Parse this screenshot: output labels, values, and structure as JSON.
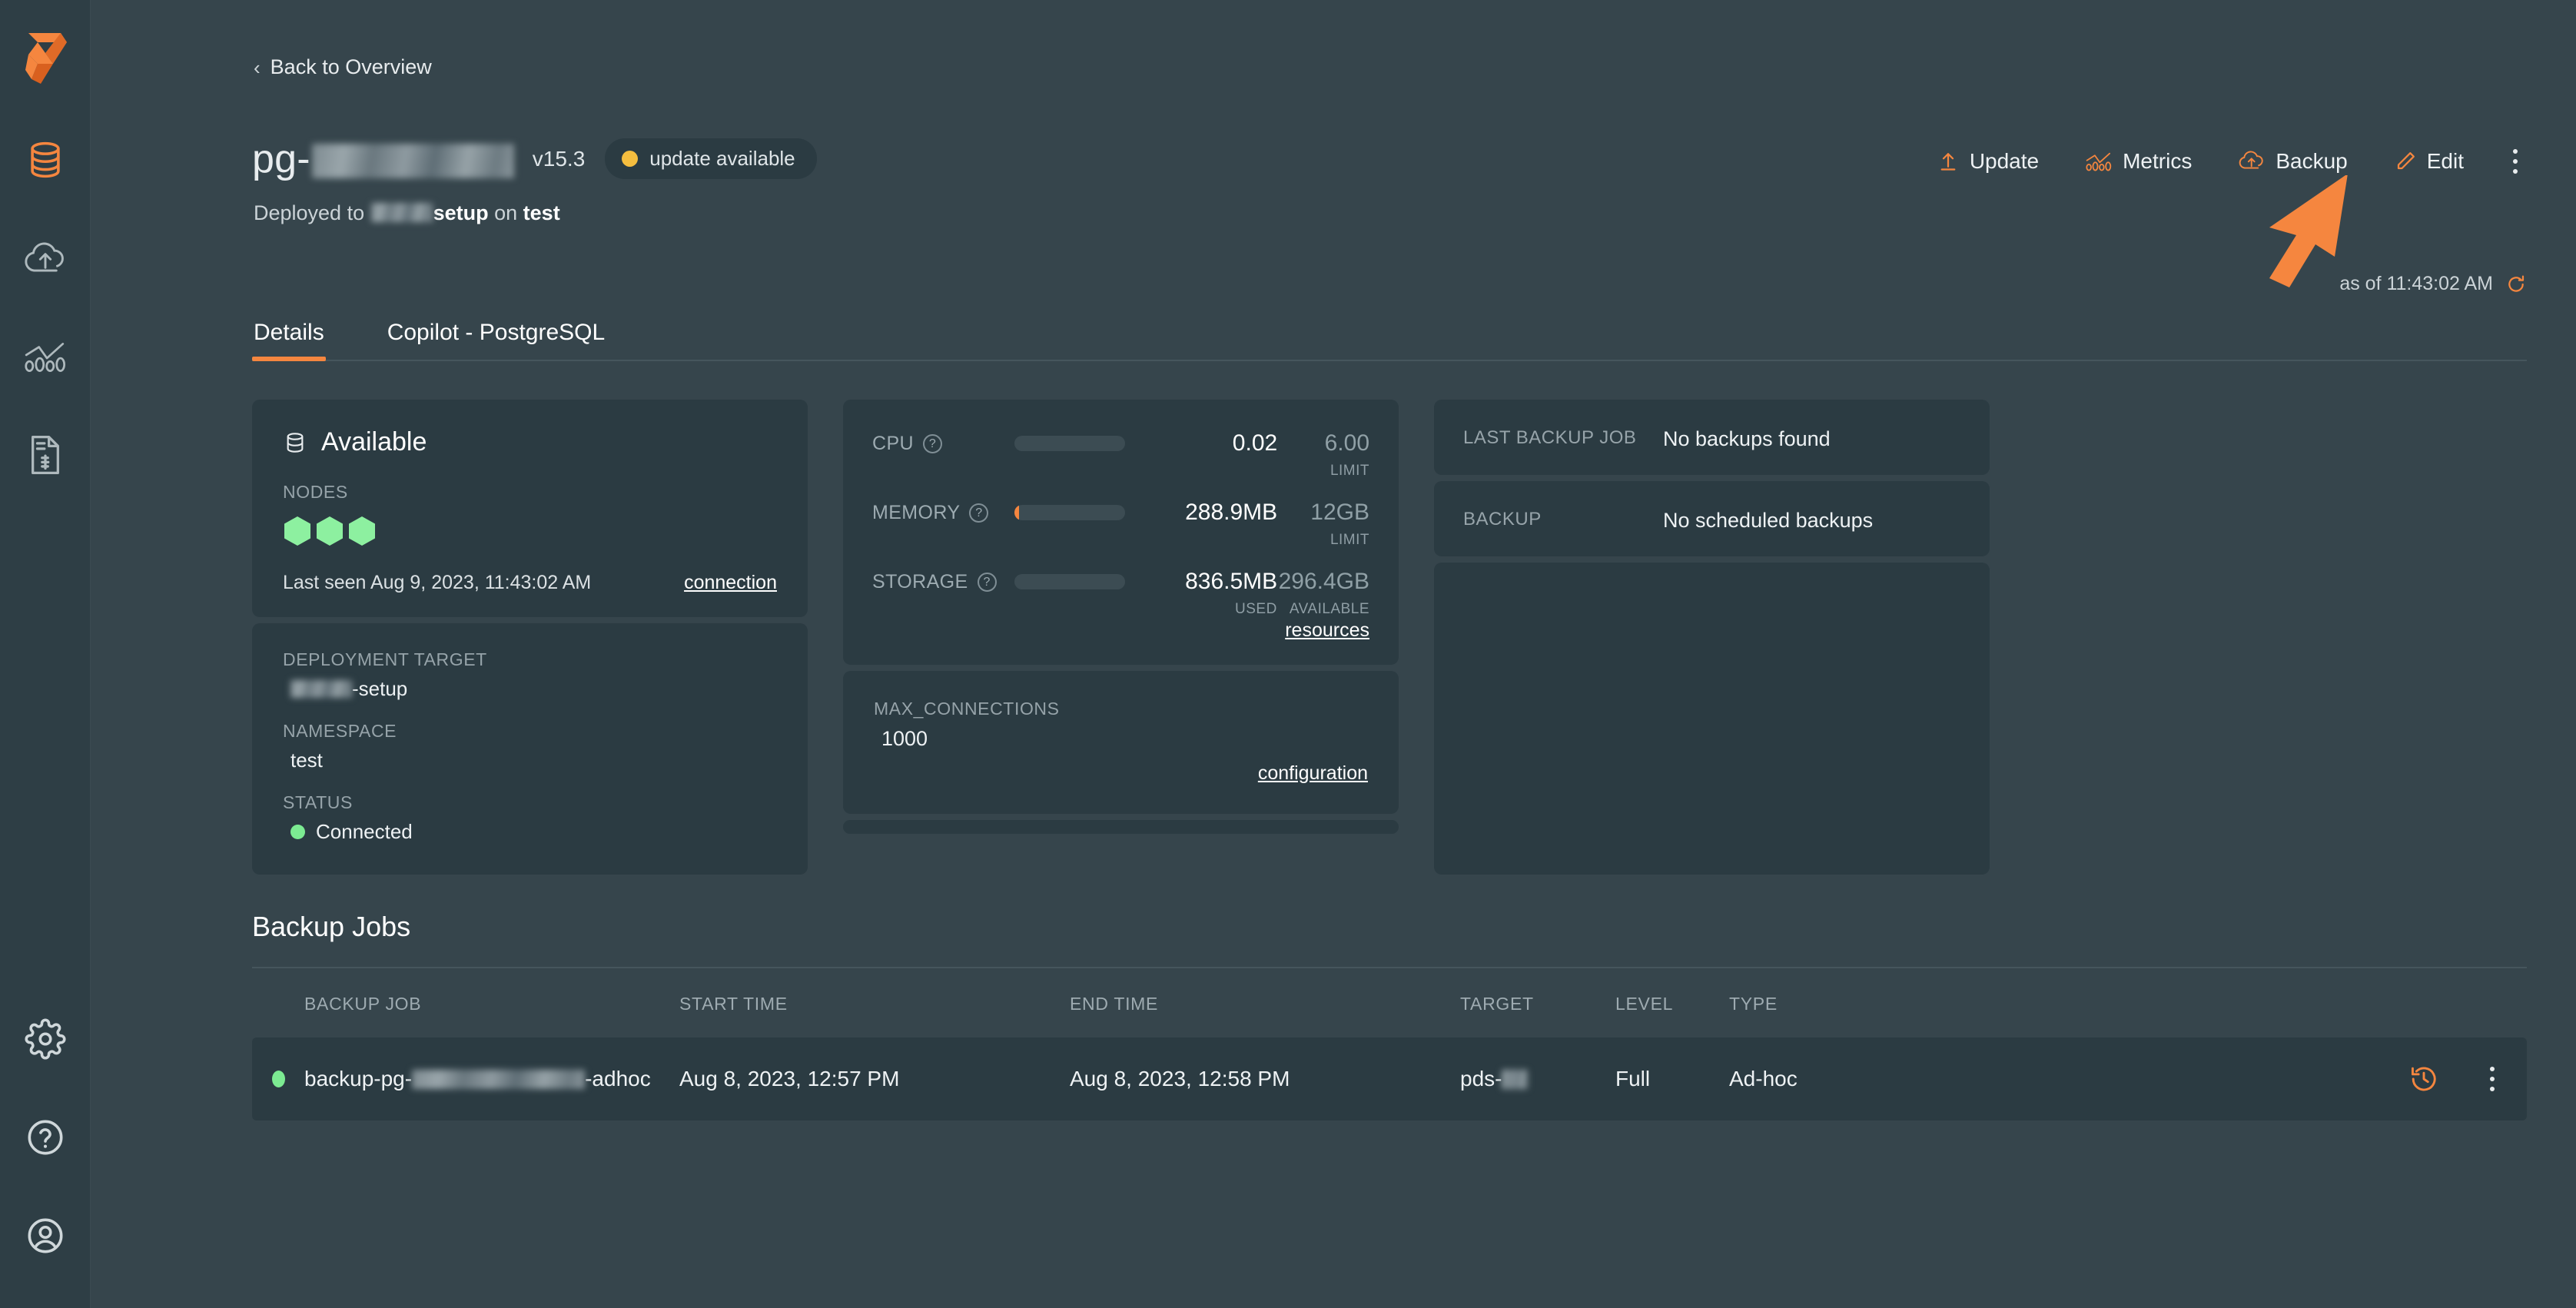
{
  "sidebar": {
    "items": [
      {
        "icon": "brand-logo-icon",
        "label": "brand-logo"
      },
      {
        "icon": "database-icon",
        "label": "Databases",
        "active": true
      },
      {
        "icon": "cloud-upload-icon",
        "label": "Deployments"
      },
      {
        "icon": "metrics-chart-icon",
        "label": "Metrics"
      },
      {
        "icon": "billing-document-icon",
        "label": "Billing"
      }
    ],
    "bottom_items": [
      {
        "icon": "gear-icon",
        "label": "Settings"
      },
      {
        "icon": "help-circle-icon",
        "label": "Help"
      },
      {
        "icon": "user-circle-icon",
        "label": "Account"
      }
    ]
  },
  "header": {
    "back_label": "Back to Overview",
    "back_icon": "chevron-left-icon",
    "title_prefix": "pg-",
    "title_redacted": true,
    "version": "v15.3",
    "badge_label": "update available",
    "badge_dot_color": "#f5be3f",
    "subtitle_prefix": "Deployed to ",
    "subtitle_target_suffix": "setup",
    "subtitle_middle": " on ",
    "subtitle_namespace": "test",
    "as_of": "as of 11:43:02 AM",
    "refresh_icon": "refresh-icon"
  },
  "actions": [
    {
      "label": "Update",
      "icon": "update-arrow-icon"
    },
    {
      "label": "Metrics",
      "icon": "metrics-chart-icon"
    },
    {
      "label": "Backup",
      "icon": "cloud-upload-icon"
    },
    {
      "label": "Edit",
      "icon": "pencil-icon"
    }
  ],
  "tabs": [
    {
      "label": "Details",
      "active": true
    },
    {
      "label": "Copilot - PostgreSQL",
      "active": false
    }
  ],
  "availability": {
    "status_title": "Available",
    "status_icon": "database-icon",
    "nodes_label": "NODES",
    "node_count": 3,
    "node_color": "#8df0a0",
    "last_seen": "Last seen Aug 9, 2023, 11:43:02 AM",
    "connection_link": "connection"
  },
  "deployment": {
    "target_label": "DEPLOYMENT TARGET",
    "target_suffix": "-setup",
    "namespace_label": "NAMESPACE",
    "namespace_value": "test",
    "status_label": "STATUS",
    "status_value": "Connected",
    "status_color": "#7ceb92"
  },
  "resources": {
    "rows": [
      {
        "name": "CPU",
        "used": "0.02",
        "cap": "6.00",
        "cap_sub": "LIMIT",
        "used_sub": "",
        "fill_pct": 0
      },
      {
        "name": "MEMORY",
        "used": "288.9MB",
        "cap": "12GB",
        "cap_sub": "LIMIT",
        "used_sub": "",
        "fill_pct": 4
      },
      {
        "name": "STORAGE",
        "used": "836.5MB",
        "cap": "296.4GB",
        "cap_sub": "AVAILABLE",
        "used_sub": "USED",
        "fill_pct": 0
      }
    ],
    "help_icon": "question-circle-icon",
    "link": "resources",
    "fill_color": "#f5863f"
  },
  "configuration": {
    "max_connections_label": "MAX_CONNECTIONS",
    "max_connections_value": "1000",
    "link": "configuration"
  },
  "backup_info": [
    {
      "label": "LAST BACKUP JOB",
      "value": "No backups found"
    },
    {
      "label": "BACKUP",
      "value": "No scheduled backups"
    }
  ],
  "backup_jobs": {
    "section_title": "Backup Jobs",
    "columns": [
      "BACKUP JOB",
      "START TIME",
      "END TIME",
      "TARGET",
      "LEVEL",
      "TYPE"
    ],
    "rows": [
      {
        "status_color": "#7ceb92",
        "job_prefix": "backup-pg-",
        "job_suffix": "-adhoc",
        "start_time": "Aug 8, 2023, 12:57 PM",
        "end_time": "Aug 8, 2023, 12:58 PM",
        "target_prefix": "pds-",
        "level": "Full",
        "type": "Ad-hoc",
        "restore_icon": "restore-history-icon",
        "menu_icon": "kebab-menu-icon"
      }
    ]
  },
  "theme": {
    "page_bg": "#36454c",
    "card_bg": "#2b3b42",
    "accent": "#f5863f",
    "sidebar_bg": "#2e3e45"
  },
  "cursor": {
    "icon": "mouse-pointer-arrow",
    "color": "#f5863f"
  }
}
